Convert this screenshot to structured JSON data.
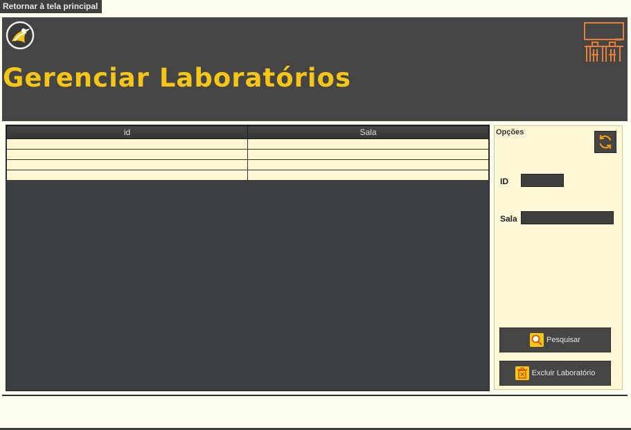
{
  "nav": {
    "return_label": "Retornar à tela principal"
  },
  "header": {
    "title": "Gerenciar Laboratórios"
  },
  "grid": {
    "columns": [
      "id",
      "Sala"
    ],
    "rows": [
      [
        "",
        ""
      ],
      [
        "",
        ""
      ],
      [
        "",
        ""
      ],
      [
        "",
        ""
      ]
    ]
  },
  "options": {
    "legend": "Opções",
    "id_label": "ID",
    "id_value": "",
    "sala_label": "Sala",
    "sala_value": "",
    "search_label": "Pesquisar",
    "delete_label": "Excluir Laboratório"
  },
  "colors": {
    "accent": "#f5c518",
    "header_bg": "#454545",
    "grid_bg": "#3c3f41",
    "row_bg": "#fff5d0",
    "panel_bg": "#fdf7d5",
    "icon_orange": "#f39c12"
  },
  "icons": [
    "bird-logo-icon",
    "classroom-icon",
    "refresh-icon",
    "search-icon",
    "trash-icon"
  ]
}
